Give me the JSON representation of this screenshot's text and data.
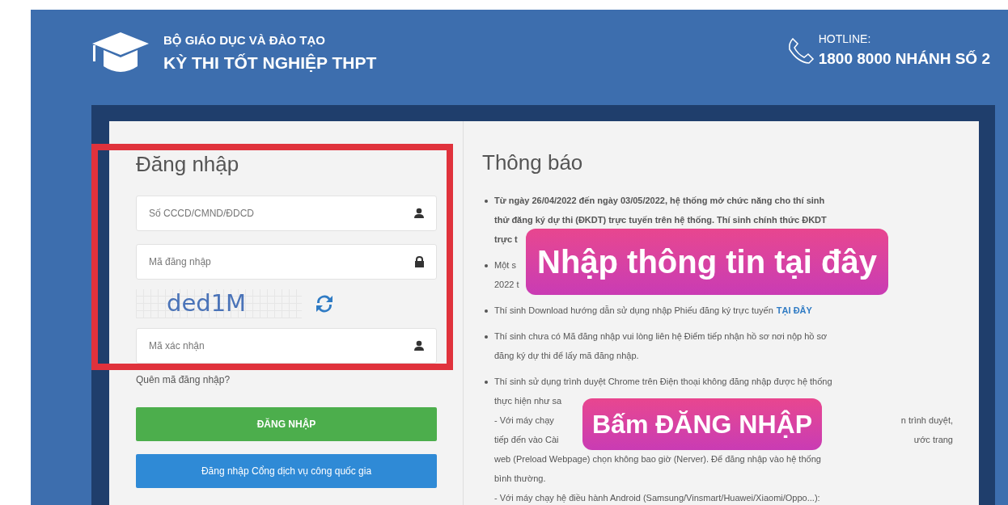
{
  "header": {
    "org": "BỘ GIÁO DỤC VÀ ĐÀO TẠO",
    "title": "KỲ THI TỐT NGHIỆP THPT",
    "hotline_label": "HOTLINE:",
    "hotline_number": "1800 8000 NHÁNH SỐ 2"
  },
  "login": {
    "title": "Đăng nhập",
    "items": [
      {
        "kind": "user_field",
        "placeholder": "Số CCCD/CMND/ĐDCD"
      },
      {
        "kind": "lock_field",
        "placeholder": "Mã đăng nhập"
      },
      {
        "kind": "captcha",
        "text": "ded1M"
      },
      {
        "kind": "user_field",
        "placeholder": "Mã xác nhận"
      }
    ],
    "forgot_link": "Quên mã đăng nhập?",
    "buttons": [
      {
        "kind": "login",
        "label": "ĐĂNG NHẬP"
      },
      {
        "kind": "national",
        "label": "Đăng nhập Cổng dịch vụ công quốc gia"
      }
    ]
  },
  "notice": {
    "title": "Thông báo",
    "items": [
      {
        "bold": true,
        "lines": [
          {
            "text": "Từ ngày 26/04/2022 đến ngày 03/05/2022, hệ thống mở chức năng cho thí sinh"
          },
          {
            "text": "thử đăng ký dự thi (ĐKDT) trực tuyến trên hệ thống. Thí sinh chính thức ĐKDT"
          },
          {
            "text": "trực t"
          }
        ]
      },
      {
        "bold": false,
        "lines": [
          {
            "text": "Một s"
          },
          {
            "text": "2022 t"
          }
        ]
      },
      {
        "bold": false,
        "lines": [
          {
            "text": "Thí sinh Download hướng dẫn sử dụng nhập Phiếu đăng ký trực tuyến",
            "link": "TẠI ĐÂY"
          }
        ]
      },
      {
        "bold": false,
        "lines": [
          {
            "text": "Thí sinh chưa có Mã đăng nhập vui lòng liên hệ Điểm tiếp nhận hồ sơ nơi nộp hồ sơ"
          },
          {
            "text": "đăng ký dự thi để lấy mã đăng nhập."
          }
        ]
      },
      {
        "bold": false,
        "lines": [
          {
            "text": "Thí sinh sử dụng trình duyệt Chrome trên Điện thoại không đăng nhập được hệ thống"
          },
          {
            "text": "thực hiện như sa"
          },
          {
            "text": " - Với máy chạy",
            "tail": "n trình duyệt,"
          },
          {
            "text": "tiếp đến vào Cài",
            "tail": "ước trang"
          },
          {
            "text": "web (Preload Webpage) chọn không bao giờ (Nerver). Để đăng nhập vào hệ thống"
          },
          {
            "text": "bình thường."
          },
          {
            "text": " - Với máy chạy hệ điều hành Android (Samsung/Vinsmart/Huawei/Xiaomi/Oppo...):"
          }
        ]
      }
    ]
  },
  "callouts": [
    {
      "text": "Nhập thông tin tại đây"
    },
    {
      "text": "Bấm ĐĂNG NHẬP"
    }
  ]
}
